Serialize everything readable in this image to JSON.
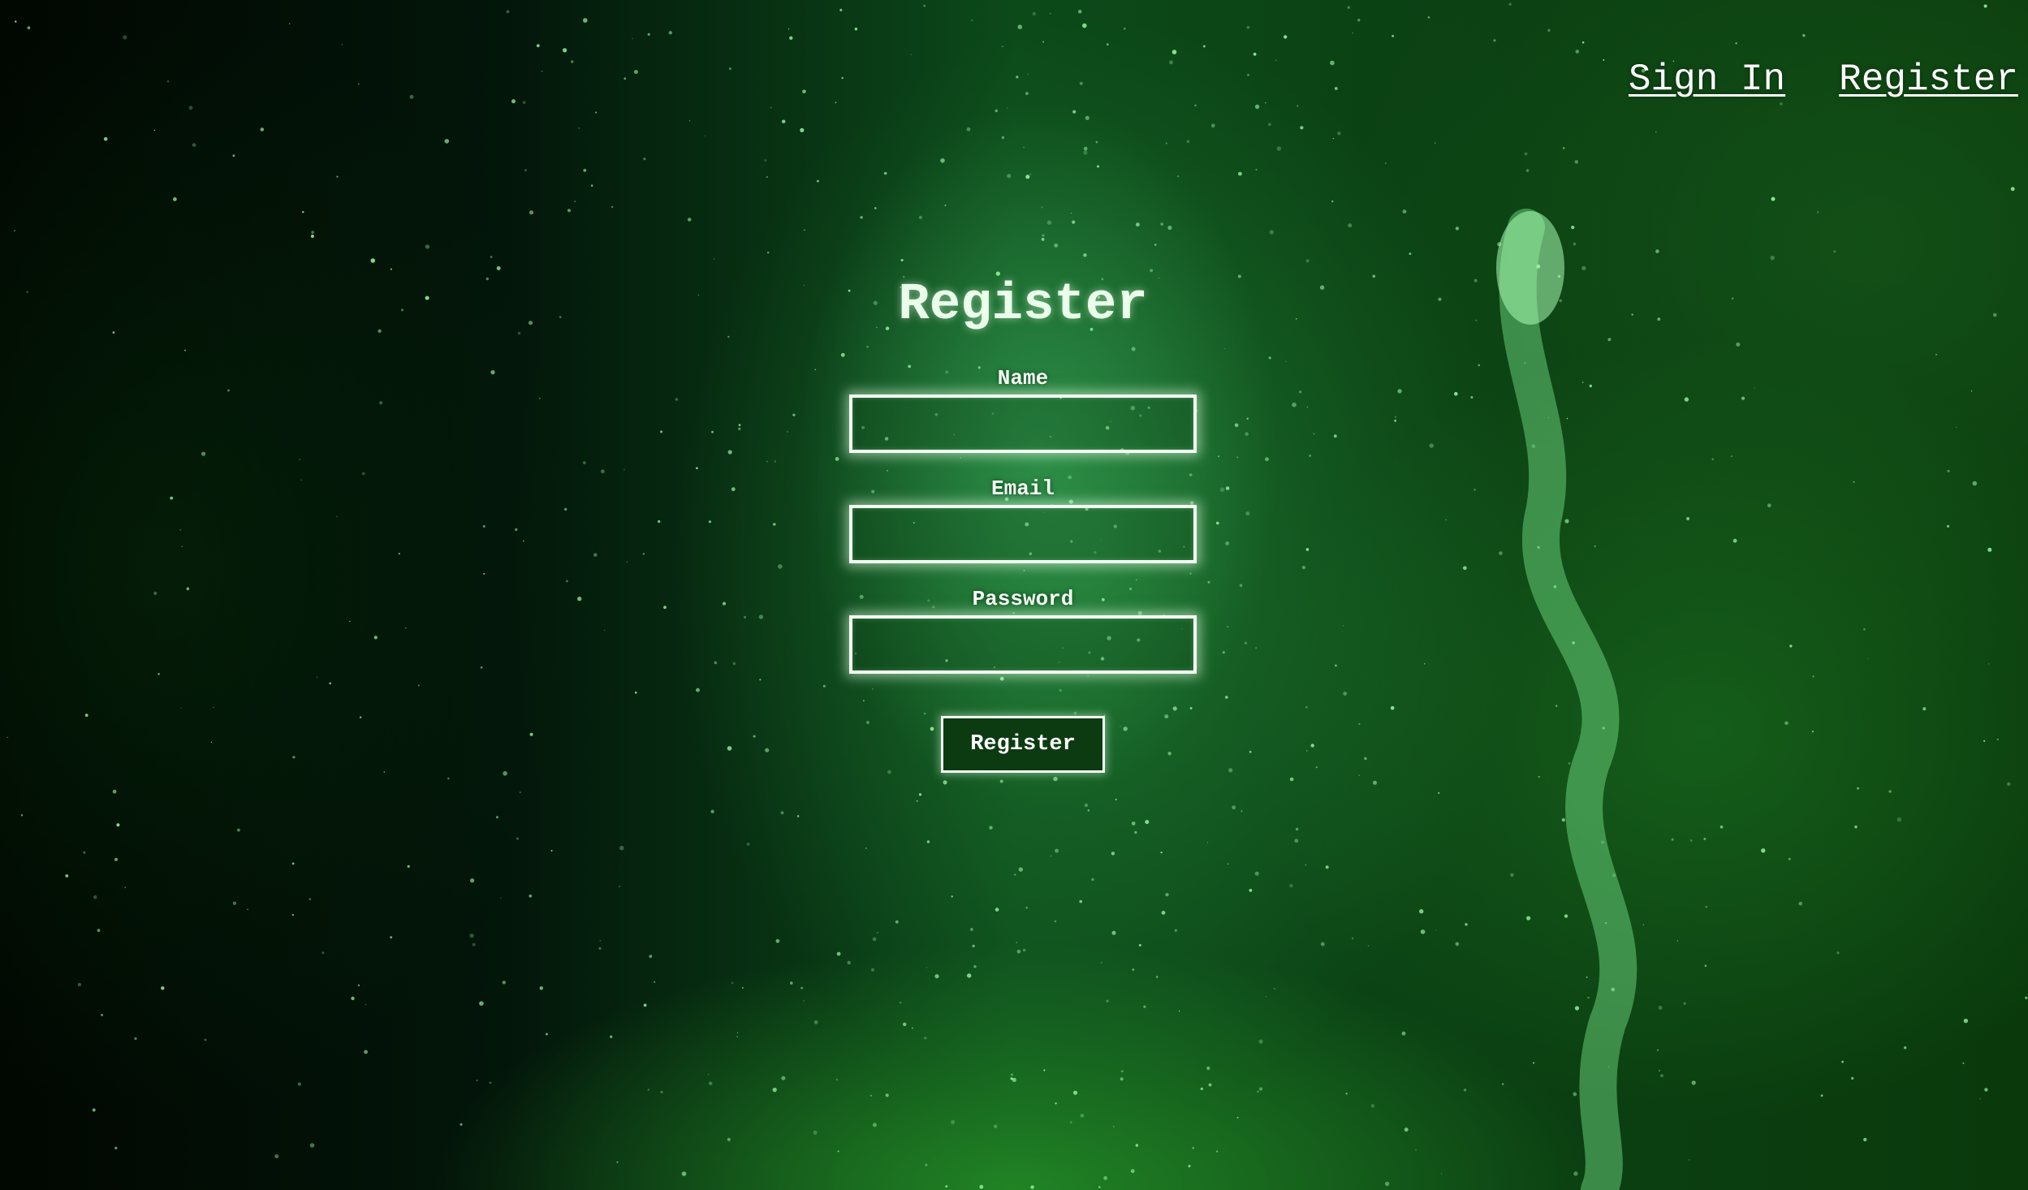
{
  "nav": {
    "sign_in": "Sign In",
    "register": "Register"
  },
  "form": {
    "title": "Register",
    "fields": [
      {
        "label": "Name",
        "value": "",
        "placeholder": ""
      },
      {
        "label": "Email",
        "value": "",
        "placeholder": ""
      },
      {
        "label": "Password",
        "value": "",
        "placeholder": ""
      }
    ],
    "submit_label": "Register"
  },
  "colors": {
    "background_dark": "#020a02",
    "background_green": "#0c4a1a",
    "text": "#f2fff2",
    "button_fill": "#0c3a11"
  }
}
